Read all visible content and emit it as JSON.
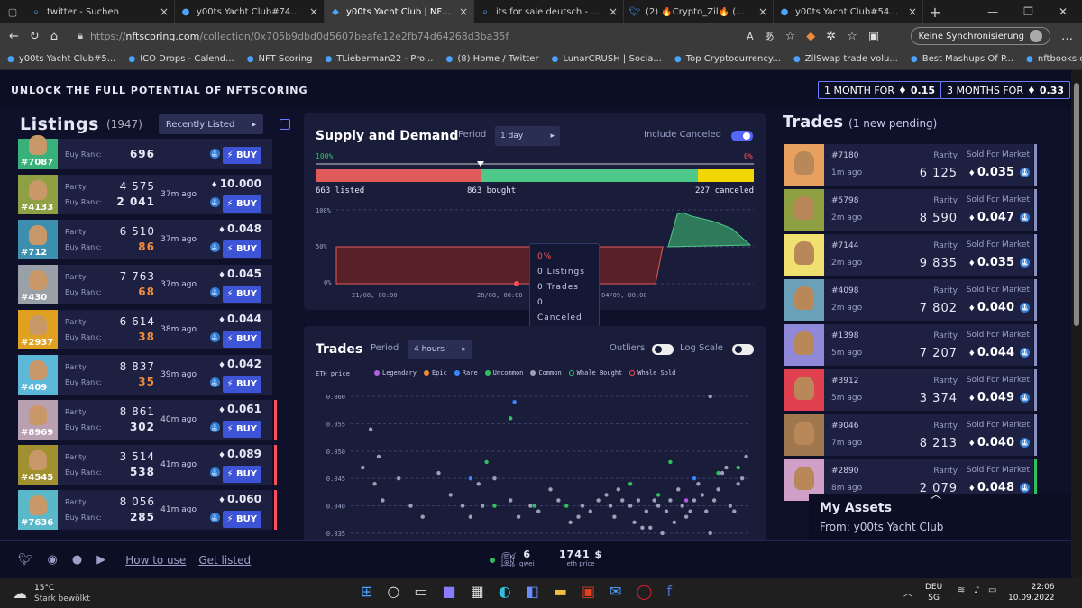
{
  "browser": {
    "tabs": [
      {
        "label": "twitter - Suchen",
        "icon": "search-icon"
      },
      {
        "label": "y00ts Yacht Club#7489 - y00",
        "icon": "opensea-icon"
      },
      {
        "label": "y00ts Yacht Club | NFT Scori",
        "icon": "nftscoring-icon",
        "active": true
      },
      {
        "label": "its for sale deutsch - Suche",
        "icon": "search-icon"
      },
      {
        "label": "(2) 🔥Crypto_Zil🔥 (@Trus",
        "icon": "twitter-icon"
      },
      {
        "label": "y00ts Yacht Club#543 - y00",
        "icon": "opensea-icon"
      }
    ],
    "url_prefix": "https://",
    "url_host": "nftscoring.com",
    "url_path": "/collection/0x705b9dbd0d5607beafe12e2fb74d64268d3ba35f",
    "sync_label": "Keine Synchronisierung",
    "bookmarks": [
      "y00ts Yacht Club#5...",
      "ICO Drops - Calend...",
      "NFT Scoring",
      "TLieberman22 - Pro...",
      "(8) Home / Twitter",
      "LunarCRUSH | Socia...",
      "Top Cryptocurrency...",
      "ZilSwap trade volu...",
      "Best Mashups Of P...",
      "nftbooks coin - Bing"
    ]
  },
  "banner": {
    "text": "UNLOCK THE FULL POTENTIAL OF NFTSCORING",
    "plan1_label": "1 MONTH FOR",
    "plan1_price": "0.15",
    "plan2_label": "3 MONTHS FOR",
    "plan2_price": "0.33"
  },
  "listings": {
    "title": "Listings",
    "count": "(1947)",
    "sort": "Recently Listed",
    "rarity_label": "Rarity:",
    "buyrank_label": "Buy Rank:",
    "buy_label": "BUY",
    "items": [
      {
        "id": "#7087",
        "rarity": "",
        "rank": "696",
        "time": "",
        "price": "",
        "color": "#38b07a",
        "flag": false,
        "rank_color": "white"
      },
      {
        "id": "#4133",
        "rarity": "4 575",
        "rank": "2 041",
        "time": "37m ago",
        "price": "10.000",
        "color": "#8fa043",
        "flag": false,
        "rank_color": "white"
      },
      {
        "id": "#712",
        "rarity": "6 510",
        "rank": "86",
        "time": "37m ago",
        "price": "0.048",
        "color": "#3d8fb0",
        "flag": false,
        "rank_color": "orange"
      },
      {
        "id": "#430",
        "rarity": "7 763",
        "rank": "68",
        "time": "37m ago",
        "price": "0.045",
        "color": "#9aa0a8",
        "flag": false,
        "rank_color": "orange"
      },
      {
        "id": "#2937",
        "rarity": "6 614",
        "rank": "38",
        "time": "38m ago",
        "price": "0.044",
        "color": "#e0a020",
        "flag": false,
        "rank_color": "orange"
      },
      {
        "id": "#409",
        "rarity": "8 837",
        "rank": "35",
        "time": "39m ago",
        "price": "0.042",
        "color": "#5bb8d8",
        "flag": false,
        "rank_color": "orange"
      },
      {
        "id": "#8969",
        "rarity": "8 861",
        "rank": "302",
        "time": "40m ago",
        "price": "0.061",
        "color": "#b8a0b0",
        "flag": true,
        "rank_color": "white"
      },
      {
        "id": "#4545",
        "rarity": "3 514",
        "rank": "538",
        "time": "41m ago",
        "price": "0.089",
        "color": "#a09030",
        "flag": true,
        "rank_color": "white"
      },
      {
        "id": "#7636",
        "rarity": "8 056",
        "rank": "285",
        "time": "41m ago",
        "price": "0.060",
        "color": "#5ab8c8",
        "flag": true,
        "rank_color": "white"
      }
    ]
  },
  "supply": {
    "title": "Supply and Demand",
    "period_label": "Period",
    "period": "1 day",
    "include_canceled": "Include Canceled",
    "pct_left": "100%",
    "pct_right": "0%",
    "listed": "663 listed",
    "bought": "863 bought",
    "canceled": "227 canceled",
    "y_ticks": [
      "100%",
      "50%",
      "0%"
    ],
    "x_ticks": [
      "21/08, 00:00",
      "28/08, 00:00",
      "04/09, 00:00"
    ],
    "tooltip": {
      "pct": "0%",
      "listings": "0 Listings",
      "trades": "0 Trades",
      "canceled": "0 Canceled"
    }
  },
  "trades_chart": {
    "title": "Trades",
    "period_label": "Period",
    "period": "4 hours",
    "outliers": "Outliers",
    "log_scale": "Log Scale",
    "ylabel": "ETH price",
    "legend": [
      {
        "name": "Legendary",
        "color": "#b060e0"
      },
      {
        "name": "Epic",
        "color": "#f08a3c"
      },
      {
        "name": "Rare",
        "color": "#3a86ff"
      },
      {
        "name": "Uncommon",
        "color": "#30c060"
      },
      {
        "name": "Common",
        "color": "#9aa0b8"
      },
      {
        "name": "Whale Bought",
        "color": "#30c060",
        "ring": true
      },
      {
        "name": "Whale Sold",
        "color": "#ff4d5e",
        "ring": true
      }
    ],
    "y_ticks": [
      "0.060",
      "0.055",
      "0.050",
      "0.045",
      "0.040",
      "0.035"
    ]
  },
  "chart_data": {
    "type": "scatter",
    "ylabel": "ETH price",
    "ylim": [
      0.034,
      0.061
    ],
    "xlim": [
      0,
      100
    ],
    "grid": true,
    "series": [
      {
        "name": "Common",
        "color": "#9aa0b8",
        "points": [
          [
            3,
            0.047
          ],
          [
            5,
            0.054
          ],
          [
            6,
            0.044
          ],
          [
            8,
            0.041
          ],
          [
            12,
            0.045
          ],
          [
            15,
            0.04
          ],
          [
            18,
            0.038
          ],
          [
            22,
            0.046
          ],
          [
            25,
            0.042
          ],
          [
            28,
            0.04
          ],
          [
            30,
            0.038
          ],
          [
            32,
            0.044
          ],
          [
            36,
            0.045
          ],
          [
            40,
            0.041
          ],
          [
            42,
            0.038
          ],
          [
            45,
            0.04
          ],
          [
            47,
            0.039
          ],
          [
            50,
            0.043
          ],
          [
            52,
            0.041
          ],
          [
            55,
            0.037
          ],
          [
            58,
            0.04
          ],
          [
            60,
            0.039
          ],
          [
            62,
            0.041
          ],
          [
            64,
            0.042
          ],
          [
            65,
            0.04
          ],
          [
            66,
            0.038
          ],
          [
            67,
            0.043
          ],
          [
            68,
            0.041
          ],
          [
            70,
            0.04
          ],
          [
            71,
            0.037
          ],
          [
            72,
            0.041
          ],
          [
            73,
            0.036
          ],
          [
            74,
            0.039
          ],
          [
            75,
            0.036
          ],
          [
            76,
            0.041
          ],
          [
            77,
            0.04
          ],
          [
            78,
            0.035
          ],
          [
            79,
            0.039
          ],
          [
            80,
            0.041
          ],
          [
            81,
            0.037
          ],
          [
            82,
            0.043
          ],
          [
            83,
            0.04
          ],
          [
            84,
            0.038
          ],
          [
            85,
            0.039
          ],
          [
            86,
            0.041
          ],
          [
            87,
            0.044
          ],
          [
            88,
            0.042
          ],
          [
            89,
            0.039
          ],
          [
            90,
            0.035
          ],
          [
            91,
            0.041
          ],
          [
            92,
            0.043
          ],
          [
            93,
            0.046
          ],
          [
            94,
            0.047
          ],
          [
            95,
            0.04
          ],
          [
            96,
            0.039
          ],
          [
            97,
            0.044
          ],
          [
            98,
            0.045
          ],
          [
            99,
            0.049
          ],
          [
            90,
            0.06
          ],
          [
            7,
            0.049
          ],
          [
            33,
            0.04
          ],
          [
            57,
            0.038
          ]
        ]
      },
      {
        "name": "Uncommon",
        "color": "#30c060",
        "points": [
          [
            34,
            0.048
          ],
          [
            36,
            0.04
          ],
          [
            40,
            0.056
          ],
          [
            46,
            0.04
          ],
          [
            54,
            0.04
          ],
          [
            70,
            0.044
          ],
          [
            77,
            0.042
          ],
          [
            80,
            0.048
          ],
          [
            92,
            0.046
          ],
          [
            97,
            0.047
          ]
        ]
      },
      {
        "name": "Rare",
        "color": "#3a86ff",
        "points": [
          [
            30,
            0.045
          ],
          [
            41,
            0.059
          ],
          [
            86,
            0.045
          ]
        ]
      },
      {
        "name": "Legendary",
        "color": "#b060e0",
        "points": [
          [
            84,
            0.041
          ]
        ]
      }
    ]
  },
  "trades": {
    "title": "Trades",
    "pending": "(1 new pending)",
    "rarity_label": "Rarity",
    "sold_label": "Sold For Market",
    "items": [
      {
        "id": "#7180",
        "time": "1m ago",
        "rarity": "6 125",
        "price": "0.035",
        "color": "#e8a060",
        "flag": "#8890c0"
      },
      {
        "id": "#5798",
        "time": "2m ago",
        "rarity": "8 590",
        "price": "0.047",
        "color": "#8fa043",
        "flag": "#8890c0"
      },
      {
        "id": "#7144",
        "time": "2m ago",
        "rarity": "9 835",
        "price": "0.035",
        "color": "#f0e070",
        "flag": "#8890c0"
      },
      {
        "id": "#4098",
        "time": "2m ago",
        "rarity": "7 802",
        "price": "0.040",
        "color": "#6aa0b8",
        "flag": "#8890c0"
      },
      {
        "id": "#1398",
        "time": "5m ago",
        "rarity": "7 207",
        "price": "0.044",
        "color": "#9088d8",
        "flag": "#8890c0"
      },
      {
        "id": "#3912",
        "time": "5m ago",
        "rarity": "3 374",
        "price": "0.049",
        "color": "#e04050",
        "flag": "#8890c0"
      },
      {
        "id": "#9046",
        "time": "7m ago",
        "rarity": "8 213",
        "price": "0.040",
        "color": "#a07850",
        "flag": "#8890c0"
      },
      {
        "id": "#2890",
        "time": "8m ago",
        "rarity": "2 079",
        "price": "0.048",
        "color": "#d0a0c8",
        "flag": "#30c060"
      }
    ]
  },
  "assets": {
    "title": "My Assets",
    "from": "From: y00ts Yacht Club"
  },
  "footer": {
    "how_to_use": "How to use",
    "get_listed": "Get listed",
    "gwei": "6",
    "gwei_label": "gwei",
    "eth_price": "1741 $",
    "eth_label": "eth price"
  },
  "taskbar": {
    "temp": "15°C",
    "weather": "Stark bewölkt",
    "lang1": "DEU",
    "lang2": "SG",
    "time": "22:06",
    "date": "10.09.2022"
  }
}
